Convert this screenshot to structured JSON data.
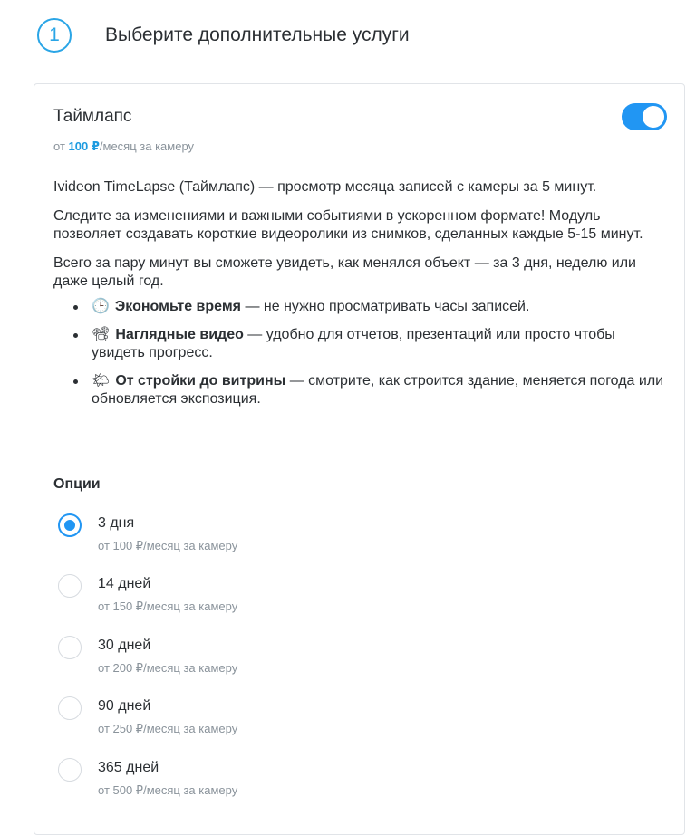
{
  "step": {
    "number": "1",
    "title": "Выберите дополнительные услуги"
  },
  "service": {
    "title": "Таймлапс",
    "price_prefix": "от",
    "price_value": "100 ₽",
    "price_suffix": "/месяц за камеру",
    "enabled": true,
    "intro_bold": "Ivideon TimeLapse (Таймлапс)",
    "intro_rest": " — просмотр месяца записей с камеры за 5 минут.",
    "paragraph1": "Следите за изменениями и важными событиями в ускоренном формате! Модуль позволяет создавать короткие видеоролики из снимков, сделанных каждые 5-15 минут.",
    "paragraph2": "Всего за пару минут вы сможете увидеть, как менялся объект — за 3 дня, неделю или даже целый год.",
    "bullets": [
      {
        "icon": "clock-icon",
        "glyph": "🕒",
        "bold": "Экономьте время",
        "text": " — не нужно просматривать часы записей."
      },
      {
        "icon": "film-camera-icon",
        "glyph": "📽",
        "bold": "Наглядные видео",
        "text": " — удобно для отчетов, презентаций или просто чтобы увидеть прогресс."
      },
      {
        "icon": "sun-cloud-icon",
        "glyph": "🌤",
        "bold": "От стройки до витрины",
        "text": " — смотрите, как строится здание, меняется погода или обновляется экспозиция."
      }
    ]
  },
  "options": {
    "heading": "Опции",
    "items": [
      {
        "label": "3 дня",
        "price": "от 100 ₽/месяц за камеру",
        "selected": true
      },
      {
        "label": "14 дней",
        "price": "от 150 ₽/месяц за камеру",
        "selected": false
      },
      {
        "label": "30 дней",
        "price": "от 200 ₽/месяц за камеру",
        "selected": false
      },
      {
        "label": "90 дней",
        "price": "от 250 ₽/месяц за камеру",
        "selected": false
      },
      {
        "label": "365 дней",
        "price": "от 500 ₽/месяц за камеру",
        "selected": false
      }
    ]
  },
  "colors": {
    "accent": "#2196f3",
    "price_accent": "#1e9be0",
    "muted": "#8a939b",
    "text": "#2b2f33",
    "border": "#e1e4e8"
  }
}
